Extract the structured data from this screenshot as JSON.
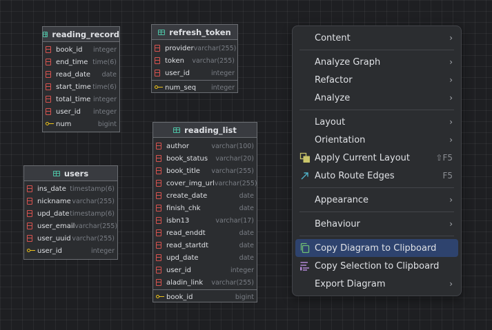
{
  "tables": {
    "reading_record": {
      "title": "reading_record",
      "columns": [
        {
          "name": "book_id",
          "type": "integer"
        },
        {
          "name": "end_time",
          "type": "time(6)"
        },
        {
          "name": "read_date",
          "type": "date"
        },
        {
          "name": "start_time",
          "type": "time(6)"
        },
        {
          "name": "total_time",
          "type": "integer"
        },
        {
          "name": "user_id",
          "type": "integer"
        }
      ],
      "key": {
        "name": "num",
        "type": "bigint"
      }
    },
    "refresh_token": {
      "title": "refresh_token",
      "columns": [
        {
          "name": "provider",
          "type": "varchar(255)"
        },
        {
          "name": "token",
          "type": "varchar(255)"
        },
        {
          "name": "user_id",
          "type": "integer"
        }
      ],
      "key": {
        "name": "num_seq",
        "type": "integer"
      }
    },
    "users": {
      "title": "users",
      "columns": [
        {
          "name": "ins_date",
          "type": "timestamp(6)"
        },
        {
          "name": "nickname",
          "type": "varchar(255)"
        },
        {
          "name": "upd_date",
          "type": "timestamp(6)"
        },
        {
          "name": "user_email",
          "type": "varchar(255)"
        },
        {
          "name": "user_uuid",
          "type": "varchar(255)"
        }
      ],
      "key": {
        "name": "user_id",
        "type": "integer"
      }
    },
    "reading_list": {
      "title": "reading_list",
      "columns": [
        {
          "name": "author",
          "type": "varchar(100)"
        },
        {
          "name": "book_status",
          "type": "varchar(20)"
        },
        {
          "name": "book_title",
          "type": "varchar(255)"
        },
        {
          "name": "cover_img_url",
          "type": "varchar(255)"
        },
        {
          "name": "create_date",
          "type": "date"
        },
        {
          "name": "finish_chk",
          "type": "date"
        },
        {
          "name": "isbn13",
          "type": "varchar(17)"
        },
        {
          "name": "read_enddt",
          "type": "date"
        },
        {
          "name": "read_startdt",
          "type": "date"
        },
        {
          "name": "upd_date",
          "type": "date"
        },
        {
          "name": "user_id",
          "type": "integer"
        },
        {
          "name": "aladin_link",
          "type": "varchar(255)"
        }
      ],
      "key": {
        "name": "book_id",
        "type": "bigint"
      }
    }
  },
  "menu": {
    "content": "Content",
    "analyze_graph": "Analyze Graph",
    "refactor": "Refactor",
    "analyze": "Analyze",
    "layout": "Layout",
    "orientation": "Orientation",
    "apply_layout": "Apply Current Layout",
    "apply_layout_shortcut": "⇧F5",
    "auto_route": "Auto Route Edges",
    "auto_route_shortcut": "F5",
    "appearance": "Appearance",
    "behaviour": "Behaviour",
    "copy_diagram": "Copy Diagram to Clipboard",
    "copy_selection": "Copy Selection to Clipboard",
    "export_diagram": "Export Diagram",
    "submenu_arrow": "›"
  },
  "colors": {
    "selection": "#2e436e",
    "column_icon": "#d9534f",
    "key_icon": "#f0c419",
    "table_icon": "#4ec3a6"
  }
}
